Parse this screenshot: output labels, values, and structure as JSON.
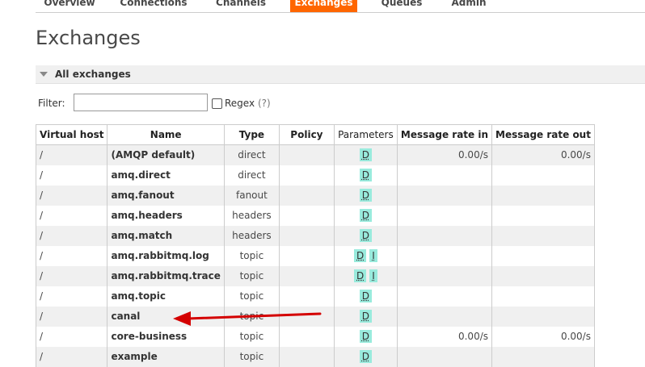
{
  "nav": {
    "items": [
      {
        "label": "Overview",
        "active": false
      },
      {
        "label": "Connections",
        "active": false
      },
      {
        "label": "Channels",
        "active": false
      },
      {
        "label": "Exchanges",
        "active": true
      },
      {
        "label": "Queues",
        "active": false
      },
      {
        "label": "Admin",
        "active": false
      }
    ]
  },
  "page": {
    "title": "Exchanges"
  },
  "section": {
    "label": "All exchanges"
  },
  "filter": {
    "label": "Filter:",
    "value": "",
    "regex_label": "Regex",
    "help": "(?)"
  },
  "table": {
    "headers": [
      "Virtual host",
      "Name",
      "Type",
      "Policy",
      "Parameters",
      "Message rate in",
      "Message rate out"
    ],
    "rows": [
      {
        "vhost": "/",
        "name": "(AMQP default)",
        "type": "direct",
        "policy": "",
        "params": [
          "D"
        ],
        "rate_in": "0.00/s",
        "rate_out": "0.00/s"
      },
      {
        "vhost": "/",
        "name": "amq.direct",
        "type": "direct",
        "policy": "",
        "params": [
          "D"
        ],
        "rate_in": "",
        "rate_out": ""
      },
      {
        "vhost": "/",
        "name": "amq.fanout",
        "type": "fanout",
        "policy": "",
        "params": [
          "D"
        ],
        "rate_in": "",
        "rate_out": ""
      },
      {
        "vhost": "/",
        "name": "amq.headers",
        "type": "headers",
        "policy": "",
        "params": [
          "D"
        ],
        "rate_in": "",
        "rate_out": ""
      },
      {
        "vhost": "/",
        "name": "amq.match",
        "type": "headers",
        "policy": "",
        "params": [
          "D"
        ],
        "rate_in": "",
        "rate_out": ""
      },
      {
        "vhost": "/",
        "name": "amq.rabbitmq.log",
        "type": "topic",
        "policy": "",
        "params": [
          "D",
          "I"
        ],
        "rate_in": "",
        "rate_out": ""
      },
      {
        "vhost": "/",
        "name": "amq.rabbitmq.trace",
        "type": "topic",
        "policy": "",
        "params": [
          "D",
          "I"
        ],
        "rate_in": "",
        "rate_out": ""
      },
      {
        "vhost": "/",
        "name": "amq.topic",
        "type": "topic",
        "policy": "",
        "params": [
          "D"
        ],
        "rate_in": "",
        "rate_out": ""
      },
      {
        "vhost": "/",
        "name": "canal",
        "type": "topic",
        "policy": "",
        "params": [
          "D"
        ],
        "rate_in": "",
        "rate_out": ""
      },
      {
        "vhost": "/",
        "name": "core-business",
        "type": "topic",
        "policy": "",
        "params": [
          "D"
        ],
        "rate_in": "0.00/s",
        "rate_out": "0.00/s"
      },
      {
        "vhost": "/",
        "name": "example",
        "type": "topic",
        "policy": "",
        "params": [
          "D"
        ],
        "rate_in": "",
        "rate_out": ""
      }
    ]
  },
  "colors": {
    "accent": "#ff6600",
    "badge": "#99ebdd",
    "arrow": "#d40000"
  }
}
